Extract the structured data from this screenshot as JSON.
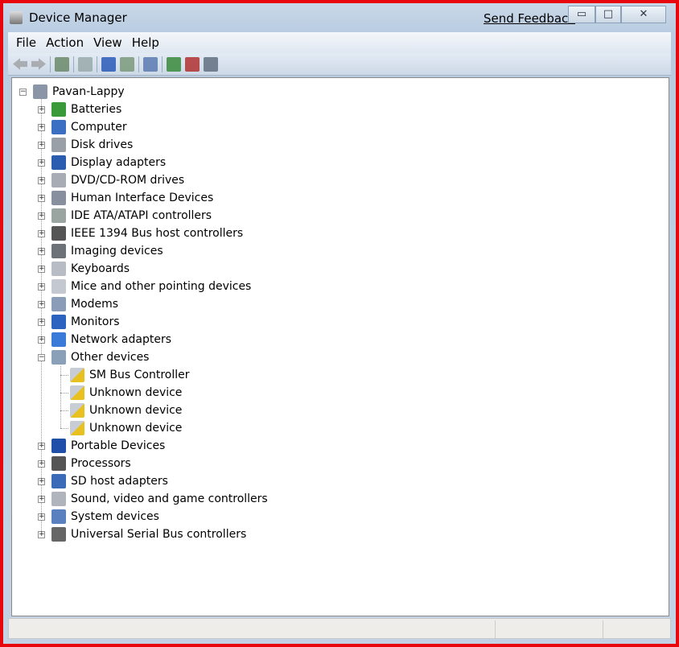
{
  "window": {
    "title": "Device Manager",
    "send_feedback": "Send Feedback",
    "minimize": "▭",
    "maximize": "□",
    "close": "✕"
  },
  "menu": [
    "File",
    "Action",
    "View",
    "Help"
  ],
  "toolbar": [
    "back-icon",
    "forward-icon",
    "show-hide-console-tree-icon",
    "properties-icon",
    "help-icon",
    "action-pane-icon",
    "scan-hardware-icon",
    "update-driver-icon",
    "uninstall-icon",
    "disable-icon"
  ],
  "tree": {
    "root": "Pavan-Lappy",
    "categories": [
      {
        "label": "Batteries",
        "color": "#3a9a3a"
      },
      {
        "label": "Computer",
        "color": "#3a6fc4"
      },
      {
        "label": "Disk drives",
        "color": "#9aa0a8"
      },
      {
        "label": "Display adapters",
        "color": "#2a5db0"
      },
      {
        "label": "DVD/CD-ROM drives",
        "color": "#a8acb4"
      },
      {
        "label": "Human Interface Devices",
        "color": "#8890a0"
      },
      {
        "label": "IDE ATA/ATAPI controllers",
        "color": "#9aa4a0"
      },
      {
        "label": "IEEE 1394 Bus host controllers",
        "color": "#555"
      },
      {
        "label": "Imaging devices",
        "color": "#6d7178"
      },
      {
        "label": "Keyboards",
        "color": "#b8bcc4"
      },
      {
        "label": "Mice and other pointing devices",
        "color": "#c4c8d0"
      },
      {
        "label": "Modems",
        "color": "#8a9cb8"
      },
      {
        "label": "Monitors",
        "color": "#2c62c0"
      },
      {
        "label": "Network adapters",
        "color": "#3a7ad8"
      },
      {
        "label": "Other devices",
        "color": "#8aa0b8",
        "expanded": true,
        "children": [
          "SM Bus Controller",
          "Unknown device",
          "Unknown device",
          "Unknown device"
        ]
      },
      {
        "label": "Portable Devices",
        "color": "#1f4fa8"
      },
      {
        "label": "Processors",
        "color": "#555"
      },
      {
        "label": "SD host adapters",
        "color": "#3a6ab8"
      },
      {
        "label": "Sound, video and game controllers",
        "color": "#b0b4bc"
      },
      {
        "label": "System devices",
        "color": "#5a80c0"
      },
      {
        "label": "Universal Serial Bus controllers",
        "color": "#666"
      }
    ]
  },
  "colors": {
    "warning": "#e8c020",
    "frame": "#e8070d"
  }
}
